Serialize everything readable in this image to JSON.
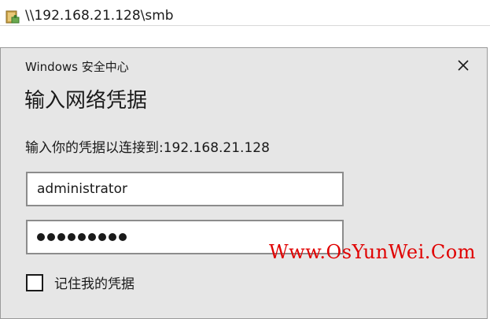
{
  "explorer": {
    "address": "\\\\192.168.21.128\\smb",
    "folder_icon": "network-folder-icon"
  },
  "dialog": {
    "source": "Windows 安全中心",
    "title": "输入网络凭据",
    "message": "输入你的凭据以连接到:192.168.21.128",
    "close_icon": "close-icon",
    "username_value": "administrator",
    "password_length": 9,
    "remember_label": "记住我的凭据",
    "remember_checked": false
  },
  "watermark": {
    "text": "Www.OsYunWei.Com",
    "color": "#e00000"
  },
  "colors": {
    "dialog_bg": "#e6e6e6",
    "input_border": "#8c8c8c"
  }
}
